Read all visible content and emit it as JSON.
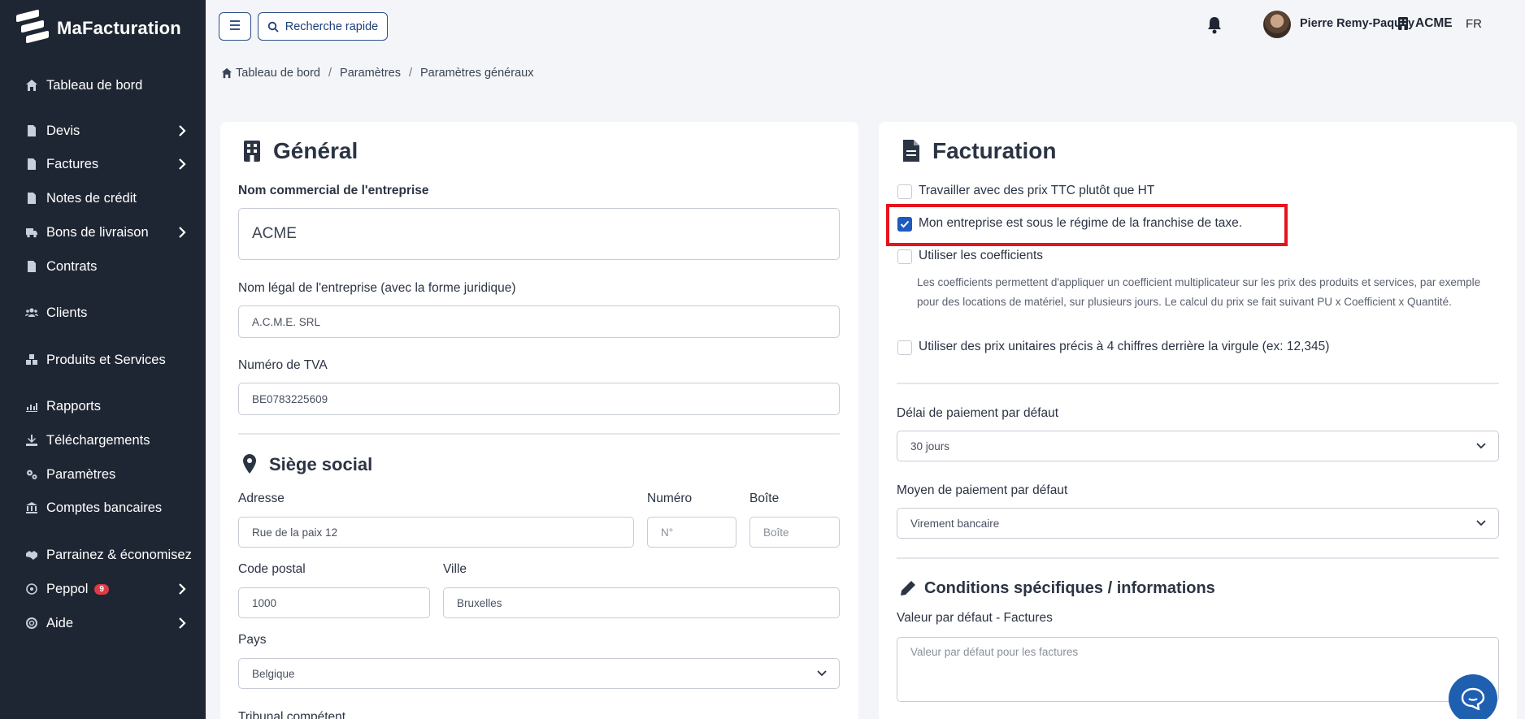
{
  "brand": {
    "name": "MaFacturation"
  },
  "sidebar": {
    "items": [
      {
        "label": "Tableau de bord",
        "icon": "home-icon",
        "chevron": false
      },
      {
        "label": "Devis",
        "icon": "file-icon",
        "chevron": true
      },
      {
        "label": "Factures",
        "icon": "file-icon",
        "chevron": true
      },
      {
        "label": "Notes de crédit",
        "icon": "file-icon",
        "chevron": false
      },
      {
        "label": "Bons de livraison",
        "icon": "truck-icon",
        "chevron": true
      },
      {
        "label": "Contrats",
        "icon": "contract-icon",
        "chevron": false
      },
      {
        "label": "Clients",
        "icon": "users-icon",
        "chevron": false
      },
      {
        "label": "Produits et Services",
        "icon": "boxes-icon",
        "chevron": false
      },
      {
        "label": "Rapports",
        "icon": "chart-icon",
        "chevron": false
      },
      {
        "label": "Téléchargements",
        "icon": "download-icon",
        "chevron": false
      },
      {
        "label": "Paramètres",
        "icon": "gears-icon",
        "chevron": false
      },
      {
        "label": "Comptes bancaires",
        "icon": "bank-icon",
        "chevron": false
      },
      {
        "label": "Parrainez & économisez",
        "icon": "handshake-icon",
        "chevron": false
      },
      {
        "label": "Peppol",
        "icon": "peppol-icon",
        "chevron": true,
        "badge": "9"
      },
      {
        "label": "Aide",
        "icon": "help-icon",
        "chevron": true
      }
    ]
  },
  "topbar": {
    "search_label": "Recherche rapide",
    "user_name": "Pierre Remy-Paquay",
    "company": "ACME",
    "lang": "FR"
  },
  "breadcrumb": {
    "items": [
      "Tableau de bord",
      "Paramètres",
      "Paramètres généraux"
    ]
  },
  "general": {
    "title": "Général",
    "commercial_name_label": "Nom commercial de l'entreprise",
    "commercial_name_value": "ACME",
    "legal_name_label": "Nom légal de l'entreprise (avec la forme juridique)",
    "legal_name_value": "A.C.M.E. SRL",
    "vat_label": "Numéro de TVA",
    "vat_value": "BE0783225609"
  },
  "siege": {
    "title": "Siège social",
    "address_label": "Adresse",
    "address_value": "Rue de la paix 12",
    "number_label": "Numéro",
    "number_placeholder": "N°",
    "box_label": "Boîte",
    "box_placeholder": "Boîte",
    "postal_label": "Code postal",
    "postal_value": "1000",
    "city_label": "Ville",
    "city_value": "Bruxelles",
    "country_label": "Pays",
    "country_value": "Belgique",
    "tribunal_label": "Tribunal compétent"
  },
  "facturation": {
    "title": "Facturation",
    "opt_ttc": "Travailler avec des prix TTC plutôt que HT",
    "opt_ttc_checked": false,
    "opt_franchise": "Mon entreprise est sous le régime de la franchise de taxe.",
    "opt_franchise_checked": true,
    "opt_coef": "Utiliser les coefficients",
    "opt_coef_checked": false,
    "coef_help": "Les coefficients permettent d'appliquer un coefficient multiplicateur sur les prix des produits et services, par exemple pour des locations de matériel, sur plusieurs jours. Le calcul du prix se fait suivant PU x Coefficient x Quantité.",
    "opt_precise": "Utiliser des prix unitaires précis à 4 chiffres derrière la virgule (ex: 12,345)",
    "opt_precise_checked": false,
    "delay_label": "Délai de paiement par défaut",
    "delay_value": "30 jours",
    "payment_label": "Moyen de paiement par défaut",
    "payment_value": "Virement bancaire"
  },
  "conditions": {
    "title": "Conditions spécifiques / informations",
    "default_invoice_label": "Valeur par défaut - Factures",
    "default_invoice_placeholder": "Valeur par défaut pour les factures"
  },
  "colors": {
    "sidebar_bg": "#1f2633",
    "accent": "#1d5bbf",
    "highlight": "#e6141c",
    "badge": "#e03b45"
  }
}
